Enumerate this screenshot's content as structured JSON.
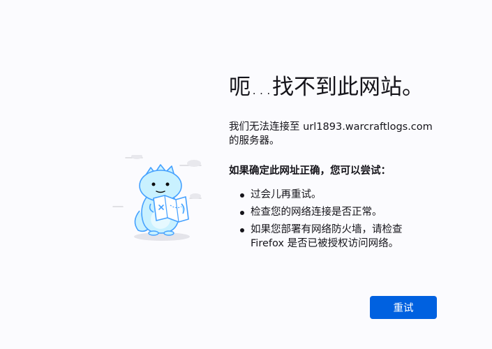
{
  "page": {
    "title": "呃…找不到此网站。",
    "description_prefix": "我们无法连接至",
    "host": "url1893.warcraftlogs.com",
    "description_suffix": "的服务器。",
    "subhead": "如果确定此网址正确，您可以尝试：",
    "tips": [
      {
        "lines": [
          "过会儿再重试。"
        ]
      },
      {
        "lines": [
          "检查您的网络连接是否正常。"
        ]
      },
      {
        "lines": [
          "如果您部署有网络防火墙，请检查",
          "Firefox 是否已被授权访问网络。"
        ]
      }
    ],
    "retry_label": "重试"
  },
  "colors": {
    "background": "#fbfbfe",
    "text": "#15141a",
    "accent": "#0061e0"
  },
  "icons": {
    "illustration": "dinosaur-reading-map-icon"
  }
}
